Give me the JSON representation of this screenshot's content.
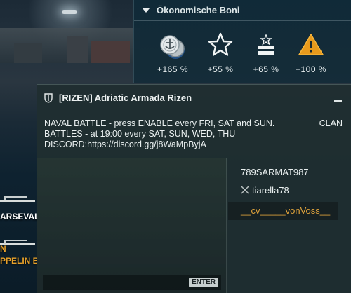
{
  "background": {
    "ships": [
      {
        "name": "ARSEVAL"
      },
      {
        "name": "N"
      },
      {
        "name": "PPELIN B"
      }
    ]
  },
  "economic_bonuses": {
    "title": "Ökonomische Boni",
    "items": [
      {
        "icon": "credits-icon",
        "value": "+165 %"
      },
      {
        "icon": "star-icon",
        "value": "+55 %"
      },
      {
        "icon": "commander-xp-icon",
        "value": "+65 %"
      },
      {
        "icon": "warning-free-xp-icon",
        "value": "+100 %"
      }
    ]
  },
  "chat": {
    "title": "[RIZEN] Adriatic Armada Rizen",
    "motd_line1": "NAVAL BATTLE - press ENABLE every FRI, SAT and SUN.",
    "motd_line2": "BATTLES - at 19:00 every SAT, SUN, WED, THU",
    "motd_line3": "DISCORD:https://discord.gg/j8WaMpByjA",
    "channel_label": "CLAN",
    "enter_label": "ENTER",
    "members": [
      {
        "name": "789SARMAT987"
      },
      {
        "name": "tiarella78",
        "icon": "crossed-swords-icon"
      },
      {
        "name": "__cv_____vonVoss__",
        "highlight": "#e0a33c"
      }
    ]
  },
  "colors": {
    "gold": "#e8a12a",
    "panel": "#102a38",
    "warning": "#f0a020"
  }
}
